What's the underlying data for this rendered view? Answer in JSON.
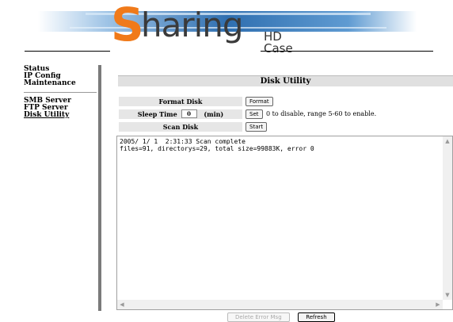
{
  "header": {
    "logo_initial": "S",
    "logo_rest": "haring",
    "logo_sub": "HD Case"
  },
  "sidebar": {
    "group1": [
      "Status",
      "IP Config",
      "Maintenance"
    ],
    "group2": [
      "SMB Server",
      "FTP Server",
      "Disk Utility"
    ]
  },
  "main": {
    "title": "Disk Utility",
    "format_label": "Format Disk",
    "format_button": "Format",
    "sleep_label": "Sleep Time",
    "sleep_value": "0",
    "sleep_unit": "(min)",
    "set_button": "Set",
    "sleep_hint": "0 to disable, range 5-60 to enable.",
    "scan_label": "Scan Disk",
    "start_button": "Start",
    "log_text": "2005/ 1/ 1  2:31:33 Scan complete\nfiles=91, directorys=29, total size=99883K, error 0"
  },
  "footer": {
    "delete_button": "Delete Error Msg",
    "refresh_button": "Refresh"
  },
  "colors": {
    "logo_orange": "#f07a1a",
    "banner_blue": "#2f6fb0"
  }
}
